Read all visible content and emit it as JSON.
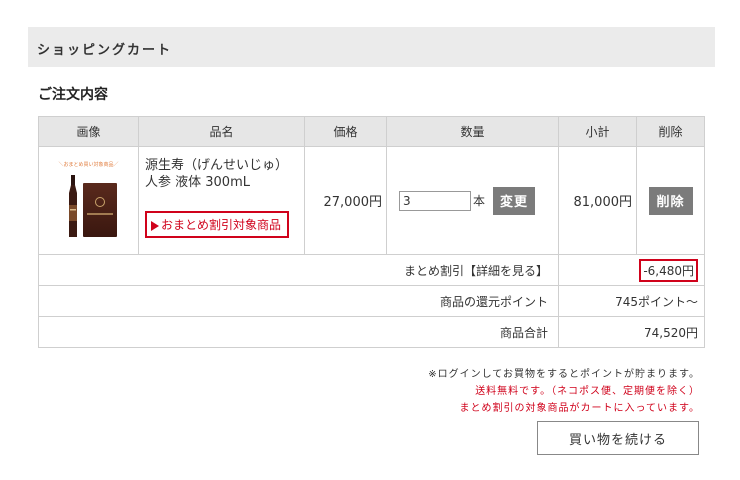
{
  "header": {
    "title": "ショッピングカート"
  },
  "order": {
    "title": "ご注文内容"
  },
  "table": {
    "headers": [
      "画像",
      "品名",
      "価格",
      "数量",
      "小計",
      "削除"
    ],
    "item": {
      "image_tag": "＼おまとめ買い対象商品／",
      "name_line1": "源生寿（げんせいじゅ）",
      "name_line2": "人参 液体 300mL",
      "badge": "おまとめ割引対象商品",
      "price": "27,000円",
      "quantity": "3",
      "unit": "本",
      "change_label": "変更",
      "subtotal": "81,000円",
      "delete_label": "削除"
    },
    "summary": {
      "discount_label": "まとめ割引【詳細を見る】",
      "discount_value": "-6,480円",
      "points_label": "商品の還元ポイント",
      "points_value": "745ポイント～",
      "total_label": "商品合計",
      "total_value": "74,520円"
    }
  },
  "notices": {
    "login": "※ログインしてお買物をするとポイントが貯まります。",
    "shipping": "送料無料です。（ネコポス便、定期便を除く）",
    "discount": "まとめ割引の対象商品がカートに入っています。"
  },
  "buttons": {
    "continue": "買い物を続ける"
  },
  "colors": {
    "accent_red": "#d0021b",
    "button_gray": "#7b7b7b",
    "header_bg": "#ebebeb"
  }
}
